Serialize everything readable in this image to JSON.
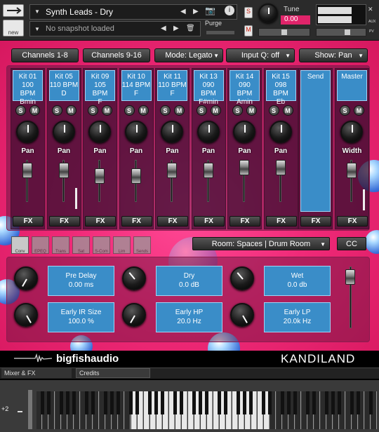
{
  "header": {
    "instrument_name": "Synth Leads - Dry",
    "snapshot_placeholder": "No snapshot loaded",
    "new_label": "new",
    "purge_label": "Purge",
    "tune_label": "Tune",
    "tune_value": "0.00",
    "s_label": "S",
    "m_label": "M",
    "aux_label": "AUX",
    "pv_label": "PV"
  },
  "topbar": {
    "channels_1": "Channels 1-8",
    "channels_2": "Channels 9-16",
    "mode": "Mode: Legato",
    "inputq": "Input Q: off",
    "show": "Show: Pan"
  },
  "channels": [
    {
      "line1": "Kit 01",
      "line2": "100 BPM",
      "line3": "Bmin"
    },
    {
      "line1": "Kit 05",
      "line2": "110 BPM",
      "line3": "D"
    },
    {
      "line1": "Kit 09",
      "line2": "105 BPM",
      "line3": "F"
    },
    {
      "line1": "Kit 10",
      "line2": "114 BPM",
      "line3": "F"
    },
    {
      "line1": "Kit 11",
      "line2": "110 BPM",
      "line3": "F"
    },
    {
      "line1": "Kit 13",
      "line2": "090 BPM",
      "line3": "F#min"
    },
    {
      "line1": "Kit 14",
      "line2": "090 BPM",
      "line3": "Amin"
    },
    {
      "line1": "Kit 15",
      "line2": "098 BPM",
      "line3": "Eb"
    }
  ],
  "mixer": {
    "solo": "S",
    "mute": "M",
    "pan_label": "Pan",
    "fx_label": "FX",
    "send_label": "Send",
    "master_label": "Master",
    "width_label": "Width"
  },
  "fx_strip": {
    "icons": [
      "Conv",
      "EPEQ",
      "Trans",
      "Sat",
      "S-Com",
      "Lim",
      "Sends"
    ],
    "room": "Room: Spaces | Drum Room",
    "cc": "CC"
  },
  "reverb": {
    "pre_delay_label": "Pre Delay",
    "pre_delay_value": "0.00 ms",
    "dry_label": "Dry",
    "dry_value": "0.0 dB",
    "wet_label": "Wet",
    "wet_value": "0.0 db",
    "early_ir_label": "Early IR Size",
    "early_ir_value": "100.0 %",
    "early_hp_label": "Early HP",
    "early_hp_value": "20.0 Hz",
    "early_lp_label": "Early LP",
    "early_lp_value": "20.0k Hz"
  },
  "footer": {
    "brand": "bigfishaudio",
    "product": "KANDILAND",
    "tab_mixer": "Mixer & FX",
    "tab_credits": "Credits",
    "octave": "+2"
  },
  "colors": {
    "accent": "#f02a78",
    "panel_blue": "#3a8dc8"
  }
}
